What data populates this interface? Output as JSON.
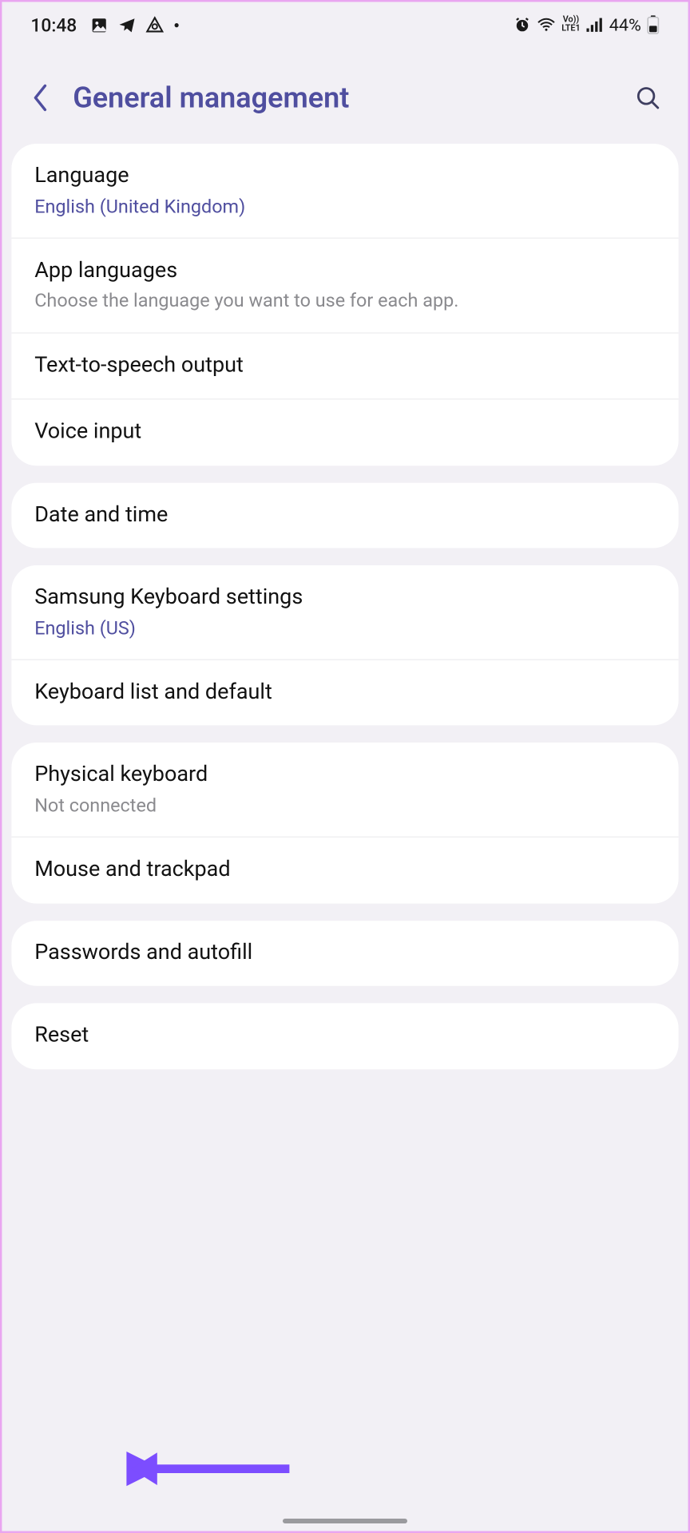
{
  "status": {
    "time": "10:48",
    "battery": "44%"
  },
  "header": {
    "title": "General management"
  },
  "groups": [
    {
      "items": [
        {
          "id": "language",
          "title": "Language",
          "subtitle": "English (United Kingdom)",
          "subtype": "accent"
        },
        {
          "id": "app-languages",
          "title": "App languages",
          "subtitle": "Choose the language you want to use for each app.",
          "subtype": "muted"
        },
        {
          "id": "tts",
          "title": "Text-to-speech output"
        },
        {
          "id": "voice-input",
          "title": "Voice input"
        }
      ]
    },
    {
      "items": [
        {
          "id": "date-time",
          "title": "Date and time"
        }
      ]
    },
    {
      "items": [
        {
          "id": "samsung-keyboard",
          "title": "Samsung Keyboard settings",
          "subtitle": "English (US)",
          "subtype": "accent"
        },
        {
          "id": "keyboard-list",
          "title": "Keyboard list and default"
        }
      ]
    },
    {
      "items": [
        {
          "id": "physical-keyboard",
          "title": "Physical keyboard",
          "subtitle": "Not connected",
          "subtype": "muted"
        },
        {
          "id": "mouse-trackpad",
          "title": "Mouse and trackpad"
        }
      ]
    },
    {
      "items": [
        {
          "id": "passwords-autofill",
          "title": "Passwords and autofill"
        }
      ]
    },
    {
      "items": [
        {
          "id": "reset",
          "title": "Reset"
        }
      ]
    }
  ],
  "annotation": {
    "points_to": "reset"
  }
}
